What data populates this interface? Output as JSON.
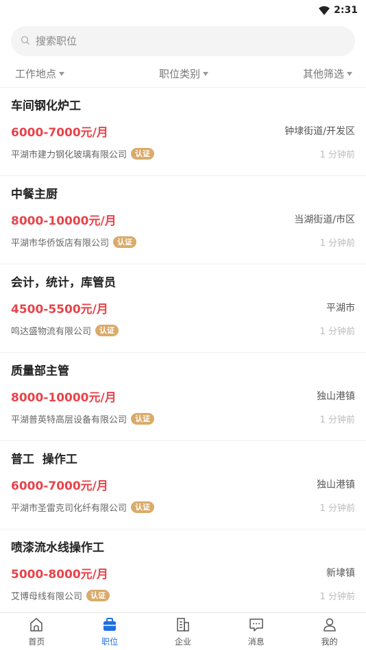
{
  "status": {
    "time": "2:31"
  },
  "search": {
    "placeholder": "搜索职位"
  },
  "filters": [
    {
      "label": "工作地点"
    },
    {
      "label": "职位类别"
    },
    {
      "label": "其他筛选"
    }
  ],
  "jobs": [
    {
      "title": "车间钢化炉工",
      "salary": "6000-7000元/月",
      "location": "钟埭街道/开发区",
      "company": "平湖市建力钢化玻璃有限公司",
      "badge": "认证",
      "time": "1 分钟前"
    },
    {
      "title": "中餐主厨",
      "salary": "8000-10000元/月",
      "location": "当湖街道/市区",
      "company": "平湖市华侨饭店有限公司",
      "badge": "认证",
      "time": "1 分钟前"
    },
    {
      "title": "会计，统计，库管员",
      "salary": "4500-5500元/月",
      "location": "平湖市",
      "company": "鸣达盛物流有限公司",
      "badge": "认证",
      "time": "1 分钟前"
    },
    {
      "title": "质量部主管",
      "salary": "8000-10000元/月",
      "location": "独山港镇",
      "company": "平湖普英特高层设备有限公司",
      "badge": "认证",
      "time": "1 分钟前"
    },
    {
      "title": "普工  操作工",
      "salary": "6000-7000元/月",
      "location": "独山港镇",
      "company": "平湖市圣雷克司化纤有限公司",
      "badge": "认证",
      "time": "1 分钟前"
    },
    {
      "title": "喷漆流水线操作工",
      "salary": "5000-8000元/月",
      "location": "新埭镇",
      "company": "艾博母线有限公司",
      "badge": "认证",
      "time": "1 分钟前"
    }
  ],
  "tabs": [
    {
      "label": "首页",
      "icon": "home-icon"
    },
    {
      "label": "职位",
      "icon": "briefcase-icon"
    },
    {
      "label": "企业",
      "icon": "building-icon"
    },
    {
      "label": "消息",
      "icon": "message-icon"
    },
    {
      "label": "我的",
      "icon": "user-icon"
    }
  ],
  "colors": {
    "accent": "#1e6fe0",
    "salary": "#e8434a",
    "badge": "#d9ab6a"
  }
}
